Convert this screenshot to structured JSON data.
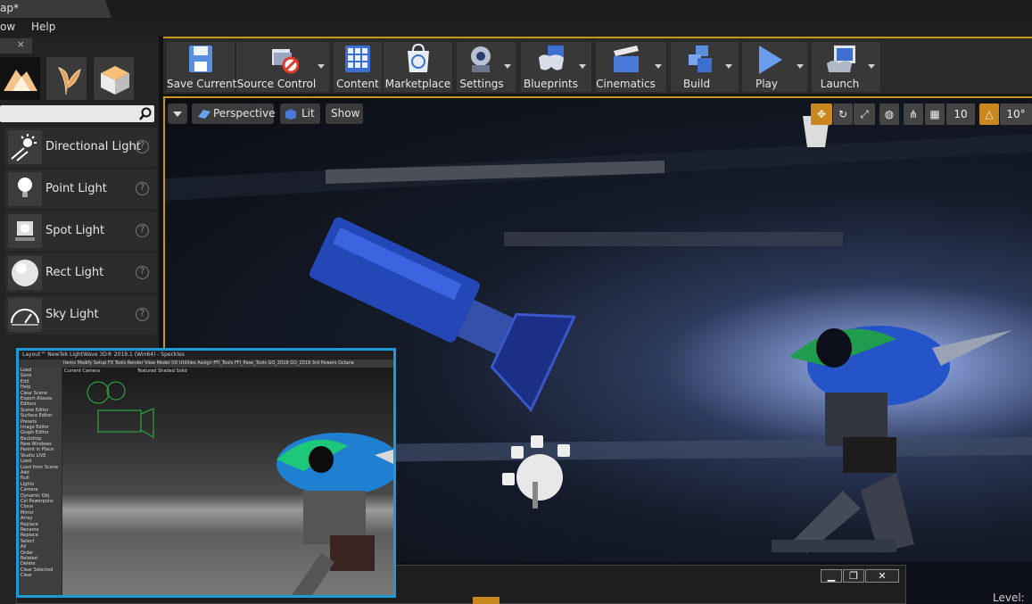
{
  "window": {
    "title": "ap*"
  },
  "menu": {
    "window": "ow",
    "help": "Help"
  },
  "modes_close": "×",
  "search": {
    "placeholder": ""
  },
  "lights": [
    {
      "label": "Directional Light",
      "help": "?"
    },
    {
      "label": "Point Light",
      "help": "?"
    },
    {
      "label": "Spot Light",
      "help": "?"
    },
    {
      "label": "Rect Light",
      "help": "?"
    },
    {
      "label": "Sky Light",
      "help": "?"
    }
  ],
  "toolbar": {
    "save_current": "Save Current",
    "source_control": "Source Control",
    "content": "Content",
    "marketplace": "Marketplace",
    "settings": "Settings",
    "blueprints": "Blueprints",
    "cinematics": "Cinematics",
    "build": "Build",
    "play": "Play",
    "launch": "Launch"
  },
  "viewport": {
    "perspective": "Perspective",
    "lit": "Lit",
    "show": "Show",
    "grid_snap": "10",
    "rotation_snap": "10°"
  },
  "lightwave": {
    "title": "Layout™ NewTek LightWave 3D® 2019.1 (Win64) - Speckles",
    "camera_label": "Current Camera",
    "shading_label": "Textured Shaded Solid",
    "sidebar_items": [
      "Load",
      "Save",
      "Edit",
      "Help",
      "Clear Scene",
      "Export Aliases",
      "Editors",
      "Scene Editor",
      "Surface Editor",
      "Presets",
      "Image Editor",
      "Graph Editor",
      "Backdrop",
      "New Windows",
      "Parent in Place",
      "Studio LIVE",
      "Load",
      "Load from Scene",
      "Add",
      "Null",
      "Lights",
      "Camera",
      "Dynamic Obj",
      "Cel Powerpons",
      "Clone",
      "Mirror",
      "Array",
      "Replace",
      "Rename",
      "Replace",
      "Select",
      "All",
      "Order",
      "Related",
      "Delete",
      "Clear Selected",
      "Clear"
    ],
    "tabs": [
      "Items",
      "Modify",
      "Setup",
      "FX Tools",
      "Render",
      "View",
      "Model",
      "I/O",
      "Utilities",
      "Assign",
      "FFl_Tools",
      "FFl_Pose_Tools",
      "GO_2018",
      "GO_2019",
      "3rd Powers",
      "Octane"
    ]
  },
  "window_buttons": {
    "minimize": "▁",
    "maximize": "❐",
    "close": "✕"
  },
  "status": {
    "level": "Level:"
  }
}
